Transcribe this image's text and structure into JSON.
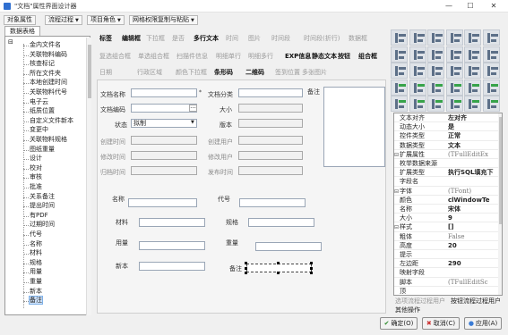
{
  "window": {
    "title": "\"文档\"属性界面设计器",
    "minimize": "—",
    "maximize": "☐",
    "close": "✕"
  },
  "menu": [
    "对象属性",
    "流程过程",
    "项目角色",
    "网格权限复制与粘贴"
  ],
  "left_panel": {
    "tab": "数据表格",
    "tree_items": [
      "金内文件名",
      "关联物料编码",
      "核查标记",
      "所在文件夹",
      "本地创建时间",
      "关联物料代号",
      "电子云",
      "纸质位置",
      "自定义文件新本",
      "变更中",
      "关联物料规格",
      "图纸重量",
      "设计",
      "校对",
      "审核",
      "批准",
      "关系备注",
      "提出时间",
      "有PDF",
      "过期时间",
      "代号",
      "名称",
      "材料",
      "规格",
      "用量",
      "重量",
      "新本",
      "备注"
    ],
    "selected": "备注"
  },
  "toolbar": {
    "row1": [
      {
        "text": "标签",
        "state": "on"
      },
      {
        "text": "编辑框",
        "state": "on"
      },
      {
        "text": "下拉框",
        "state": "off"
      },
      {
        "text": "是否",
        "state": "off"
      },
      {
        "text": "多行文本",
        "state": "on"
      },
      {
        "text": "时间",
        "state": "off"
      },
      {
        "text": "图片",
        "state": "off"
      },
      {
        "text": "时间段",
        "state": "off"
      },
      {
        "text": "时间段(折行)",
        "state": "off"
      },
      {
        "text": "数据框",
        "state": "off"
      }
    ],
    "row2": [
      {
        "text": "复选组合框",
        "state": "off"
      },
      {
        "text": "单选组合框",
        "state": "off"
      },
      {
        "text": "扫描件信息",
        "state": "off"
      },
      {
        "text": "明细单行",
        "state": "off"
      },
      {
        "text": "明细多行",
        "state": "off"
      },
      {
        "text": "EXP信息",
        "state": "on"
      },
      {
        "text": "静态文本",
        "state": "on"
      },
      {
        "text": "按钮",
        "state": "on"
      },
      {
        "text": "组合框",
        "state": "on"
      }
    ],
    "row3": [
      {
        "text": "日期",
        "state": "off"
      },
      {
        "text": "行政区域",
        "state": "off"
      },
      {
        "text": "颜色下拉框",
        "state": "off"
      },
      {
        "text": "条形码",
        "state": "on"
      },
      {
        "text": "二维码",
        "state": "on"
      },
      {
        "text": "签到位置",
        "state": "off"
      },
      {
        "text": "多张图片",
        "state": "off"
      }
    ]
  },
  "form": {
    "doc_name_label": "文档名称",
    "doc_class_label": "文档分类",
    "remark_label": "备注",
    "doc_code_label": "文档编码",
    "size_label": "大小",
    "status_label": "状态",
    "status_value": "拟制",
    "version_label": "版本",
    "create_time_label": "创建时间",
    "create_user_label": "创建用户",
    "modify_time_label": "修改时间",
    "modify_user_label": "修改用户",
    "archive_time_label": "归档时间",
    "publish_time_label": "发布时间",
    "name_label": "名称",
    "code_label": "代号",
    "material_label": "材料",
    "spec_label": "规格",
    "usage_label": "用量",
    "weight_label": "重量",
    "new_label": "新本",
    "note_label": "备注",
    "ellipsis": "···"
  },
  "properties": [
    {
      "key": "文本对齐",
      "value": "左对齐",
      "expand": "",
      "style": "bold"
    },
    {
      "key": "动态大小",
      "value": "是",
      "expand": "",
      "style": "bold"
    },
    {
      "key": "控件类型",
      "value": "正常",
      "expand": "",
      "style": "bold"
    },
    {
      "key": "数据类型",
      "value": "文本",
      "expand": "",
      "style": "bold"
    },
    {
      "key": "扩展属性",
      "value": "(TFullEditEx",
      "expand": "⊟",
      "style": "gray"
    },
    {
      "key": "枚举数据来源",
      "value": "",
      "expand": "",
      "style": ""
    },
    {
      "key": "扩展类型",
      "value": "执行SQL填充下",
      "expand": "",
      "style": "bold"
    },
    {
      "key": "字段名",
      "value": "",
      "expand": "",
      "style": ""
    },
    {
      "key": "字体",
      "value": "(TFont)",
      "expand": "⊟",
      "style": "gray"
    },
    {
      "key": "颜色",
      "value": "clWindowTe",
      "expand": "",
      "style": "bold"
    },
    {
      "key": "名称",
      "value": "宋体",
      "expand": "",
      "style": "bold"
    },
    {
      "key": "大小",
      "value": "9",
      "expand": "",
      "style": "bold"
    },
    {
      "key": "样式",
      "value": "[]",
      "expand": "⊟",
      "style": "bold"
    },
    {
      "key": "粗体",
      "value": "False",
      "expand": "",
      "style": "gray"
    },
    {
      "key": "高度",
      "value": "20",
      "expand": "",
      "style": "bold"
    },
    {
      "key": "提示",
      "value": "",
      "expand": "",
      "style": ""
    },
    {
      "key": "左边距",
      "value": "290",
      "expand": "",
      "style": "bold"
    },
    {
      "key": "映射字段",
      "value": "",
      "expand": "",
      "style": ""
    },
    {
      "key": "脚本",
      "value": "(TFullEditSc",
      "expand": "",
      "style": "gray"
    },
    {
      "key": "顶",
      "value": "",
      "expand": "",
      "style": ""
    }
  ],
  "prop_tabs": [
    "选项流程过程用户",
    "按钮流程过程用户",
    "其他操作"
  ],
  "buttons": {
    "ok": "确定(O)",
    "cancel": "取消(C)",
    "apply": "应用(A)"
  }
}
